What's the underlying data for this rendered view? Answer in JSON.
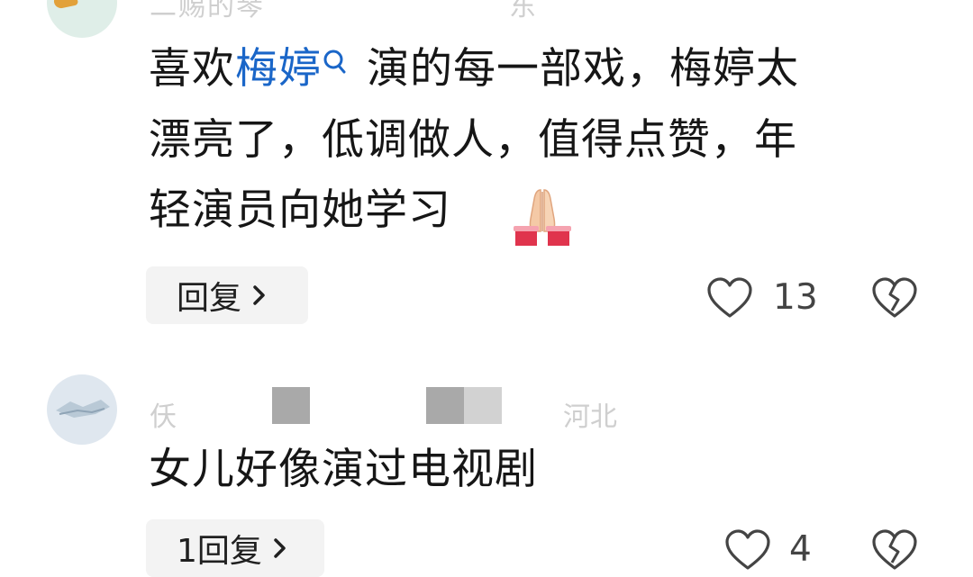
{
  "comments": [
    {
      "text_line1_before": "喜欢",
      "text_link": "梅婷",
      "text_line1_after": "演的每一部戏，梅婷太",
      "text_line2": "漂亮了，低调做人，值得点赞，年",
      "text_line3": "轻演员向她学习",
      "emoji": "folded-hands",
      "reply_label": "回复",
      "like_count": "13",
      "username_faded": "二赐的琴",
      "location_faded": "东"
    },
    {
      "username_faded": "仸",
      "location_faded": "河北",
      "text": "女儿好像演过电视剧",
      "reply_label": "1回复",
      "like_count": "4"
    }
  ],
  "colors": {
    "link": "#1a66c8",
    "text": "#161616",
    "muted": "#cfcfcf",
    "button_bg": "#f3f3f3"
  },
  "icons": [
    "search-icon",
    "folded-hands-emoji",
    "chevron-right-icon",
    "heart-icon",
    "broken-heart-icon"
  ]
}
